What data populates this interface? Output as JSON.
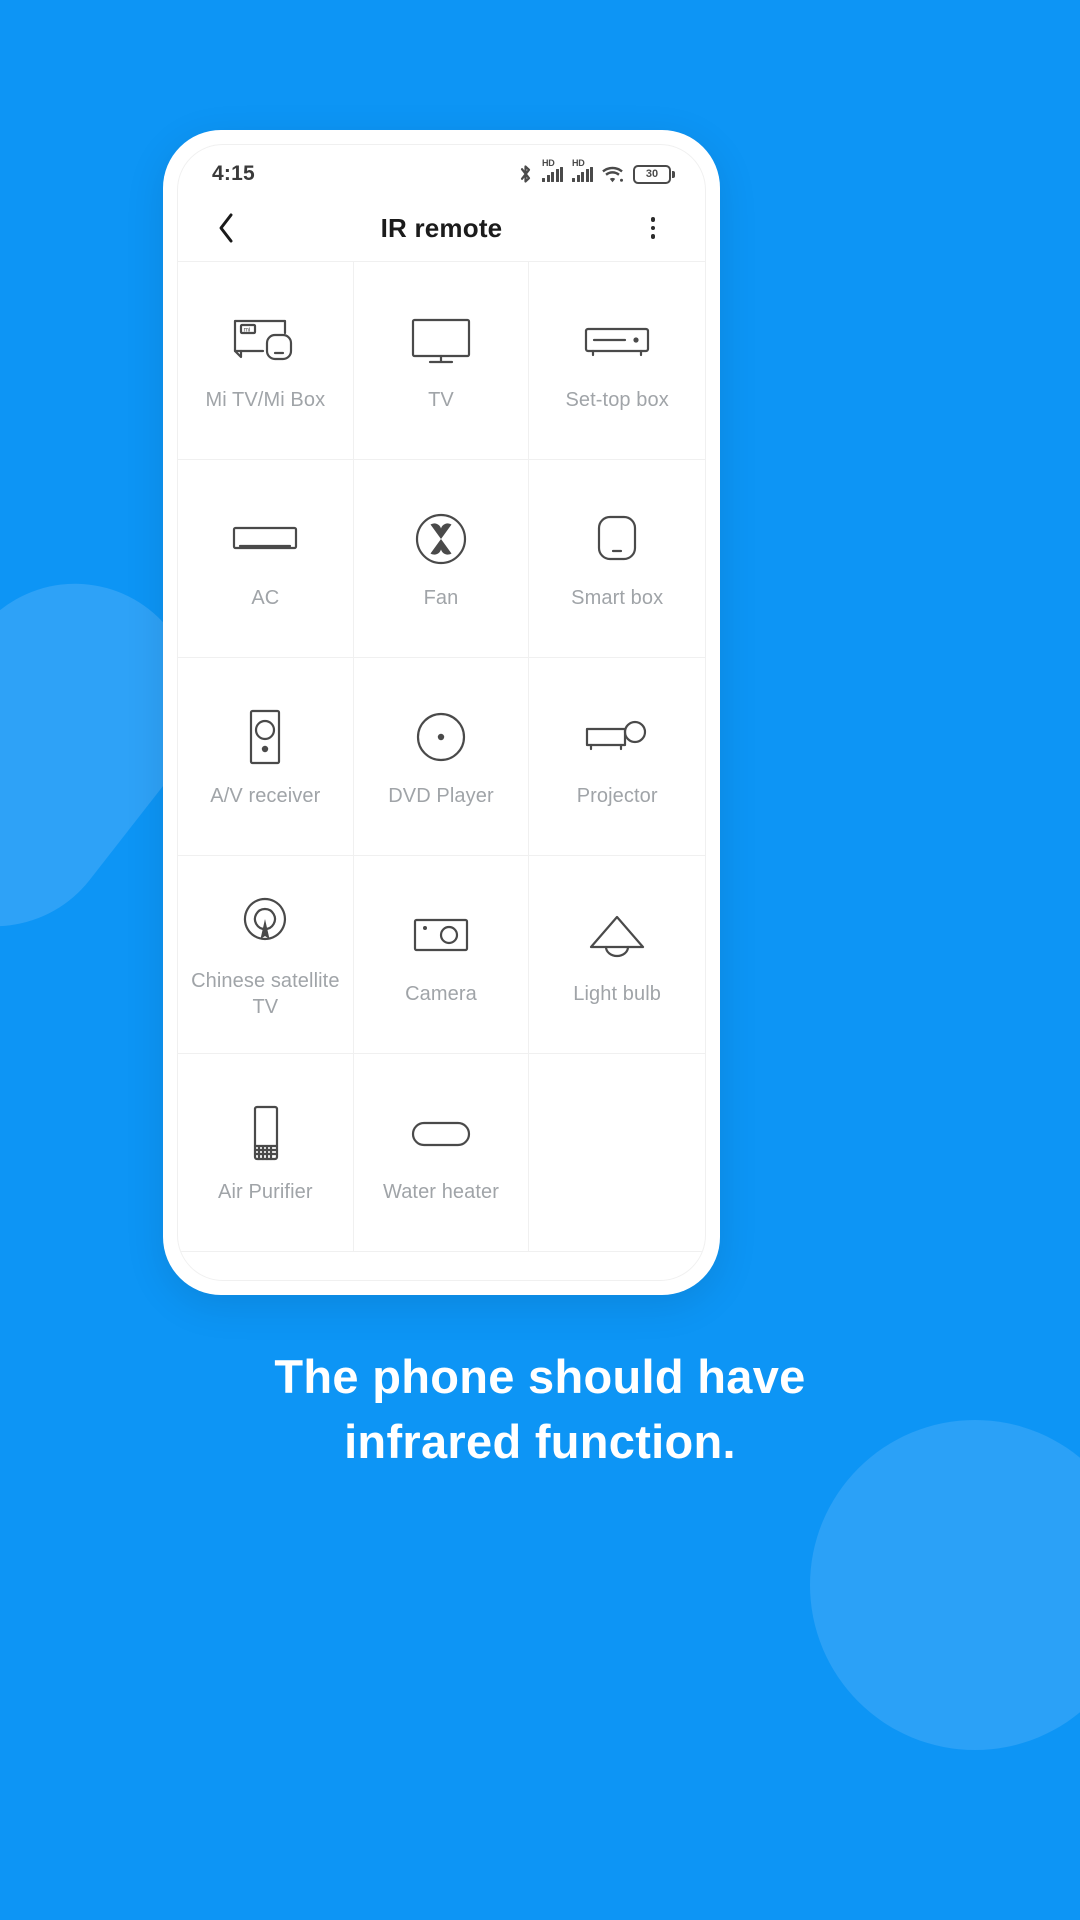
{
  "background_color": "#0d95f5",
  "phone": {
    "status_bar": {
      "clock": "4:15",
      "icons": [
        "bluetooth-icon",
        "hd-signal-icon-1",
        "hd-signal-icon-2",
        "wifi-icon",
        "battery-icon"
      ],
      "hd_label_1": "HD",
      "hd_label_2": "HD",
      "battery_level": "30"
    },
    "app_bar": {
      "back_label": "back-icon",
      "title": "IR remote",
      "more_label": "more-options-icon"
    },
    "grid": {
      "items": [
        {
          "label": "Mi TV/Mi Box",
          "icon": "mi-tv-box-icon"
        },
        {
          "label": "TV",
          "icon": "tv-icon"
        },
        {
          "label": "Set-top box",
          "icon": "set-top-box-icon"
        },
        {
          "label": "AC",
          "icon": "air-conditioner-icon"
        },
        {
          "label": "Fan",
          "icon": "fan-icon"
        },
        {
          "label": "Smart box",
          "icon": "smart-box-icon"
        },
        {
          "label": "A/V receiver",
          "icon": "av-receiver-icon"
        },
        {
          "label": "DVD Player",
          "icon": "dvd-player-icon"
        },
        {
          "label": "Projector",
          "icon": "projector-icon"
        },
        {
          "label": "Chinese satellite TV",
          "icon": "satellite-tv-icon"
        },
        {
          "label": "Camera",
          "icon": "camera-icon"
        },
        {
          "label": "Light bulb",
          "icon": "light-bulb-icon"
        },
        {
          "label": "Air Purifier",
          "icon": "air-purifier-icon"
        },
        {
          "label": "Water heater",
          "icon": "water-heater-icon"
        },
        {
          "label": "",
          "icon": ""
        }
      ]
    }
  },
  "caption": {
    "line1": "The phone should have",
    "line2": "infrared function."
  }
}
